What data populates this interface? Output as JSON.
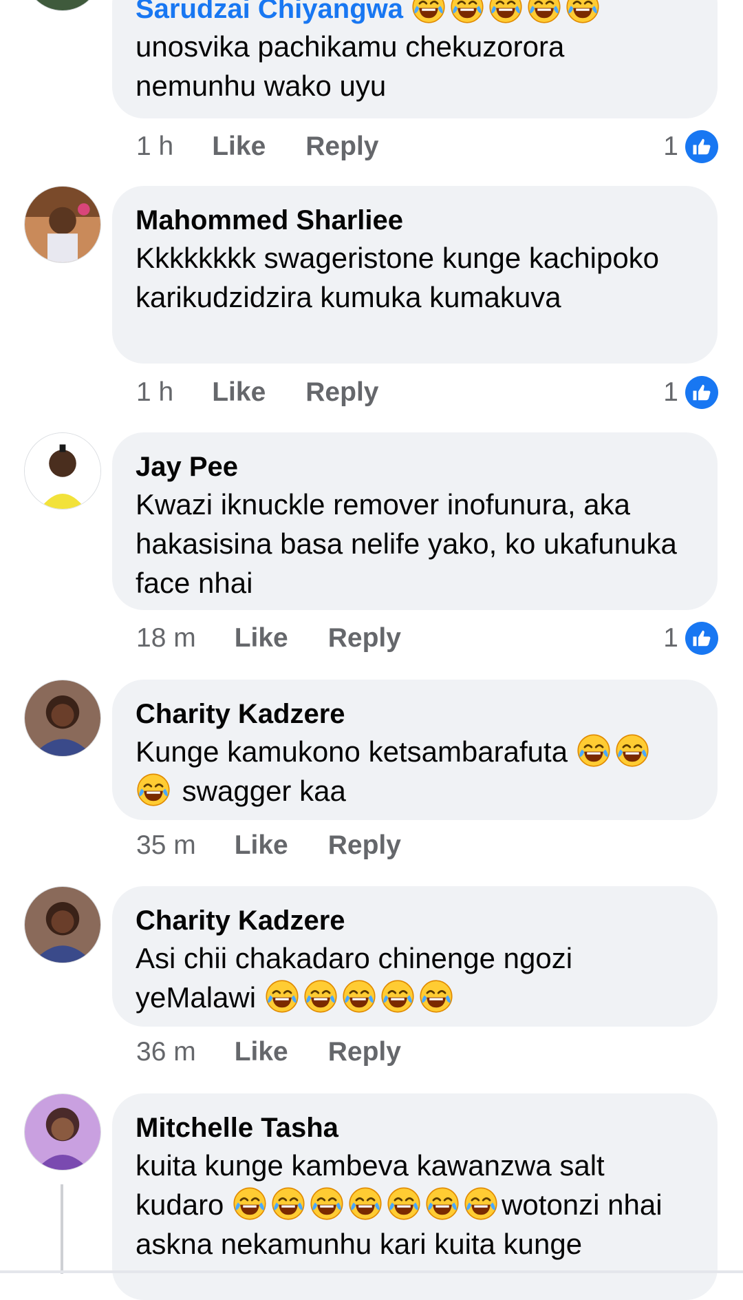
{
  "comments": [
    {
      "author": "Sarudzai Chiyangwa",
      "text": "unosvika pachikamu chekuzorora nemunhu wako uyu",
      "time": "1 h",
      "like": "Like",
      "reply": "Reply",
      "reactions": "1",
      "avatar": "avatar-green"
    },
    {
      "author": "Mahommed Sharliee",
      "text": "Kkkkkkkk swageristone kunge kachipoko karikudzidzira kumuka kumakuva",
      "time": "1 h",
      "like": "Like",
      "reply": "Reply",
      "reactions": "1"
    },
    {
      "author": "Jay Pee",
      "text": "Kwazi iknuckle remover inofunura, aka hakasisina basa nelife yako, ko ukafunuka face nhai",
      "time": "18 m",
      "like": "Like",
      "reply": "Reply",
      "reactions": "1"
    },
    {
      "author": "Charity Kadzere",
      "text_a": "Kunge kamukono ketsambarafuta",
      "text_b": "swagger kaa",
      "time": "35 m",
      "like": "Like",
      "reply": "Reply"
    },
    {
      "author": "Charity Kadzere",
      "text_a": "Asi chii chakadaro chinenge ngozi",
      "text_b": "yeMalawi",
      "time": "36 m",
      "like": "Like",
      "reply": "Reply"
    },
    {
      "author": "Mitchelle Tasha",
      "text_a": "kuita kunge kambeva kawanzwa salt",
      "text_b": "kudaro",
      "text_c": "wotonzi nhai",
      "text_d": "askna nekamunhu kari kuita kunge"
    }
  ],
  "icons": {
    "like": "thumbs-up-icon",
    "emoji": "face-with-tears-of-joy-icon"
  },
  "colors": {
    "accent": "#1877f2",
    "bubble": "#f0f2f5",
    "meta": "#65676b"
  }
}
